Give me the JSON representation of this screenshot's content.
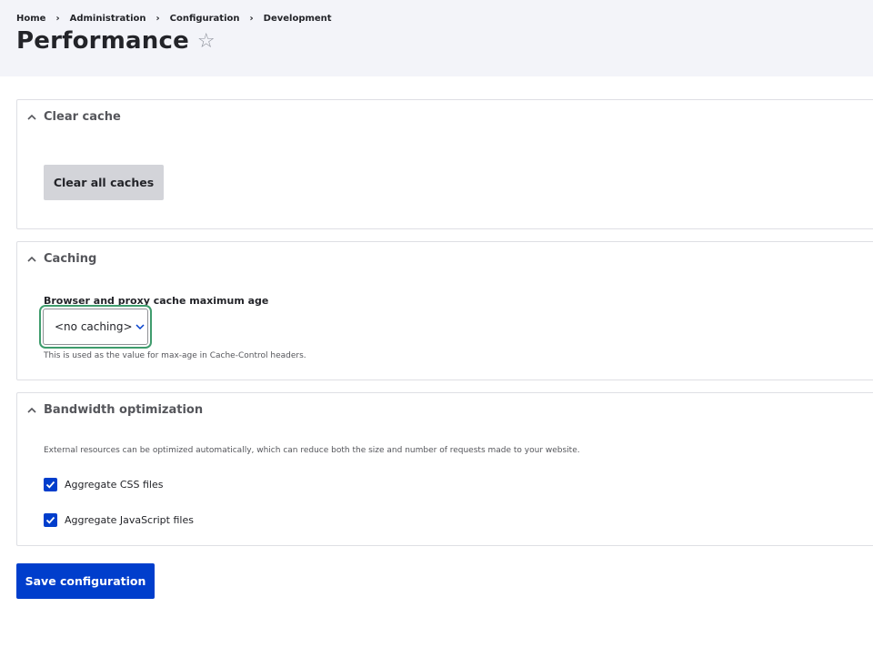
{
  "breadcrumb": {
    "items": [
      "Home",
      "Administration",
      "Configuration",
      "Development"
    ],
    "separator": "›"
  },
  "page": {
    "title": "Performance",
    "star_icon": "☆"
  },
  "clear_cache": {
    "heading": "Clear cache",
    "button_label": "Clear all caches"
  },
  "caching": {
    "heading": "Caching",
    "field_label": "Browser and proxy cache maximum age",
    "selected_value": "<no caching>",
    "description": "This is used as the value for max-age in Cache-Control headers."
  },
  "bandwidth": {
    "heading": "Bandwidth optimization",
    "description": "External resources can be optimized automatically, which can reduce both the size and number of requests made to your website.",
    "options": [
      {
        "label": "Aggregate CSS files",
        "checked": true
      },
      {
        "label": "Aggregate JavaScript files",
        "checked": true
      }
    ]
  },
  "actions": {
    "save_label": "Save configuration"
  },
  "colors": {
    "primary": "#003ecc",
    "focus_ring": "#3f9c6d",
    "header_bg": "#f3f4f9",
    "secondary_button": "#d3d4d9"
  }
}
